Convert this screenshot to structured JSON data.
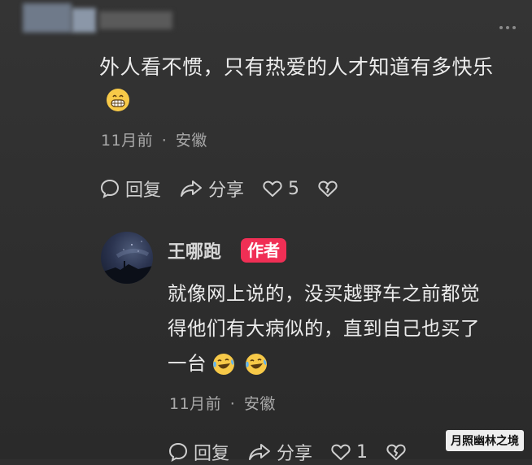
{
  "comment": {
    "text": "外人看不惯，只有热爱的人才知道有多快乐",
    "emoji": "grinning-face-emoji",
    "time": "11月前",
    "separator": "·",
    "location": "安徽",
    "reply_label": "回复",
    "share_label": "分享",
    "likes": "5"
  },
  "reply": {
    "author": "王哪跑",
    "badge": "作者",
    "text_line1": "就像网上说的，没买越野车之前都觉",
    "text_line2": "得他们有大病似的，直到自己也买了",
    "text_line3": "一台",
    "emojis": [
      "laughing-crying-emoji",
      "laughing-crying-emoji"
    ],
    "time": "11月前",
    "separator": "·",
    "location": "安徽",
    "reply_label": "回复",
    "share_label": "分享",
    "likes": "1"
  },
  "watermark": "月照幽林之境",
  "colors": {
    "background": "#2f2f2f",
    "badge": "#f02f55",
    "text": "#ececec",
    "meta": "#a9a9a9"
  }
}
